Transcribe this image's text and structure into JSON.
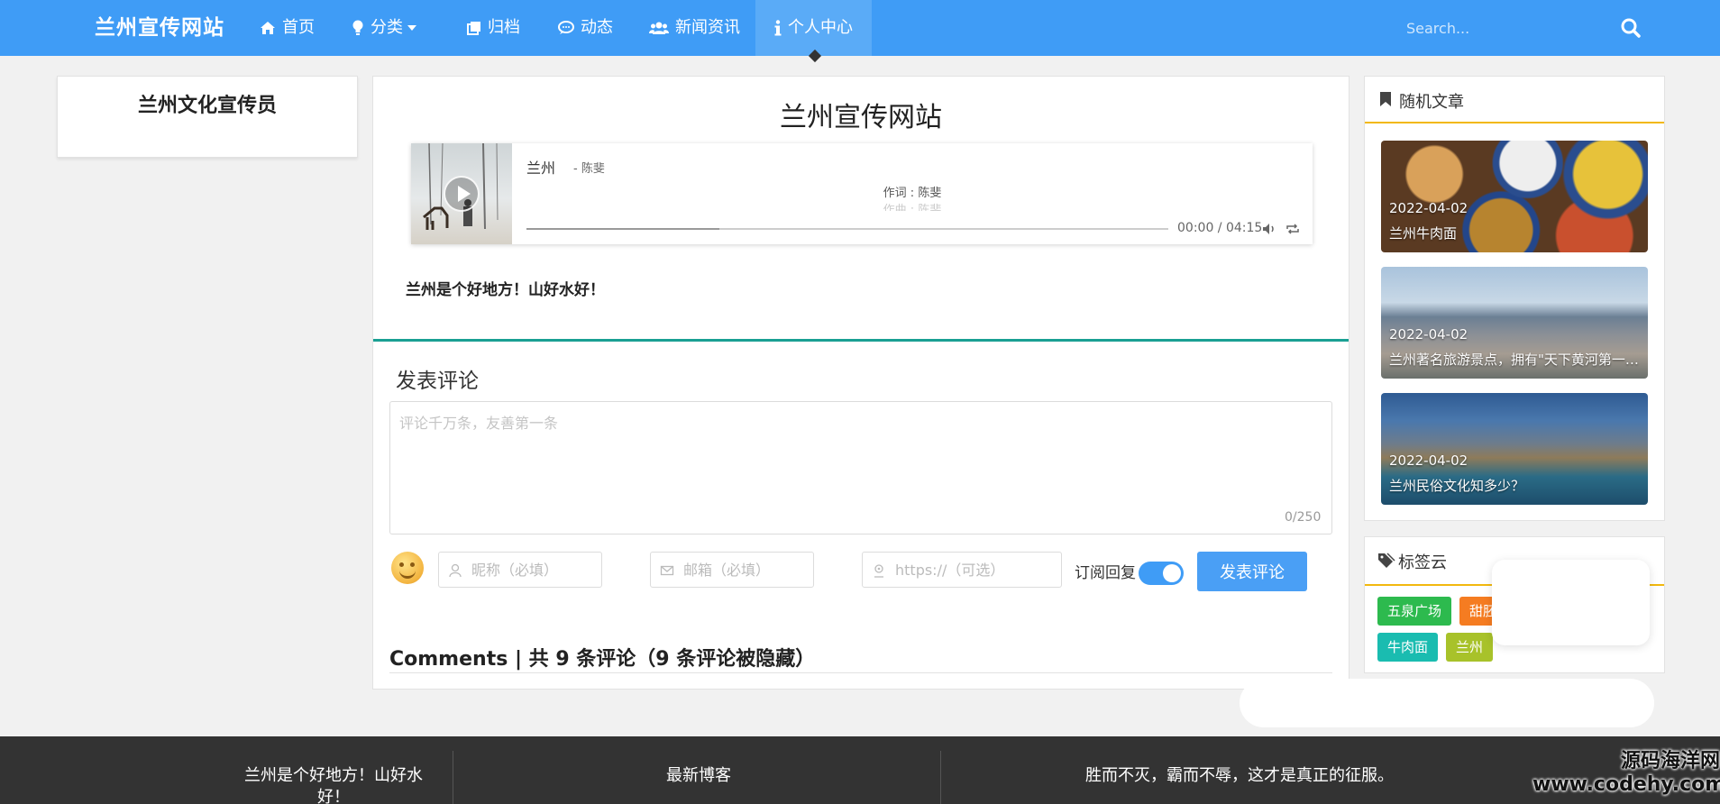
{
  "nav": {
    "brand": "兰州宣传网站",
    "items": [
      {
        "label": "首页",
        "icon": "home-icon"
      },
      {
        "label": "分类",
        "icon": "lightbulb-icon"
      },
      {
        "label": "归档",
        "icon": "copy-icon"
      },
      {
        "label": "动态",
        "icon": "chat-icon"
      },
      {
        "label": "新闻资讯",
        "icon": "users-icon"
      },
      {
        "label": "个人中心",
        "icon": "info-icon"
      }
    ],
    "search_placeholder": "Search..."
  },
  "left": {
    "title": "兰州文化宣传员"
  },
  "post": {
    "title": "兰州宣传网站",
    "body": "兰州是个好地方！山好水好！"
  },
  "player": {
    "song": "兰州",
    "artist": "- 陈斐",
    "lyric1": "作词 : 陈斐",
    "lyric2": "作曲 : 陈斐",
    "time": "00:00 / 04:15",
    "progress": 0.3
  },
  "comment": {
    "heading": "发表评论",
    "placeholder": "评论千万条，友善第一条",
    "count": "0/250",
    "nick_placeholder": "昵称（必填）",
    "email_placeholder": "邮箱（必填）",
    "url_placeholder": "https://（可选）",
    "subscribe": "订阅回复",
    "submit": "发表评论",
    "summary": "Comments | 共 9 条评论（9 条评论被隐藏）"
  },
  "sidebar": {
    "random_title": "随机文章",
    "posts": [
      {
        "date": "2022-04-02",
        "title": "兰州牛肉面"
      },
      {
        "date": "2022-04-02",
        "title": "兰州著名旅游景点，拥有\"天下黄河第一桥\"之称"
      },
      {
        "date": "2022-04-02",
        "title": "兰州民俗文化知多少？"
      }
    ],
    "tags_title": "标签云",
    "tags": [
      {
        "label": "五泉广场",
        "color": "#2dba4e"
      },
      {
        "label": "甜胚子",
        "color": "#f57c21"
      },
      {
        "label": "牛肉面",
        "color": "#1abcb0"
      },
      {
        "label": "兰州",
        "color": "#a8c22a"
      }
    ]
  },
  "footer": {
    "col1": "兰州是个好地方！山好水好！",
    "col2": "最新博客",
    "col3": "胜而不灭，霸而不辱，这才是真正的征服。"
  },
  "watermark": {
    "line1": "源码海洋网",
    "line2": "www.codehy.com"
  },
  "colors": {
    "nav_bg": "#3f9cf6",
    "accent_teal": "#1aa093",
    "accent_yellow": "#f2b80f",
    "footer_bg": "#333333"
  }
}
